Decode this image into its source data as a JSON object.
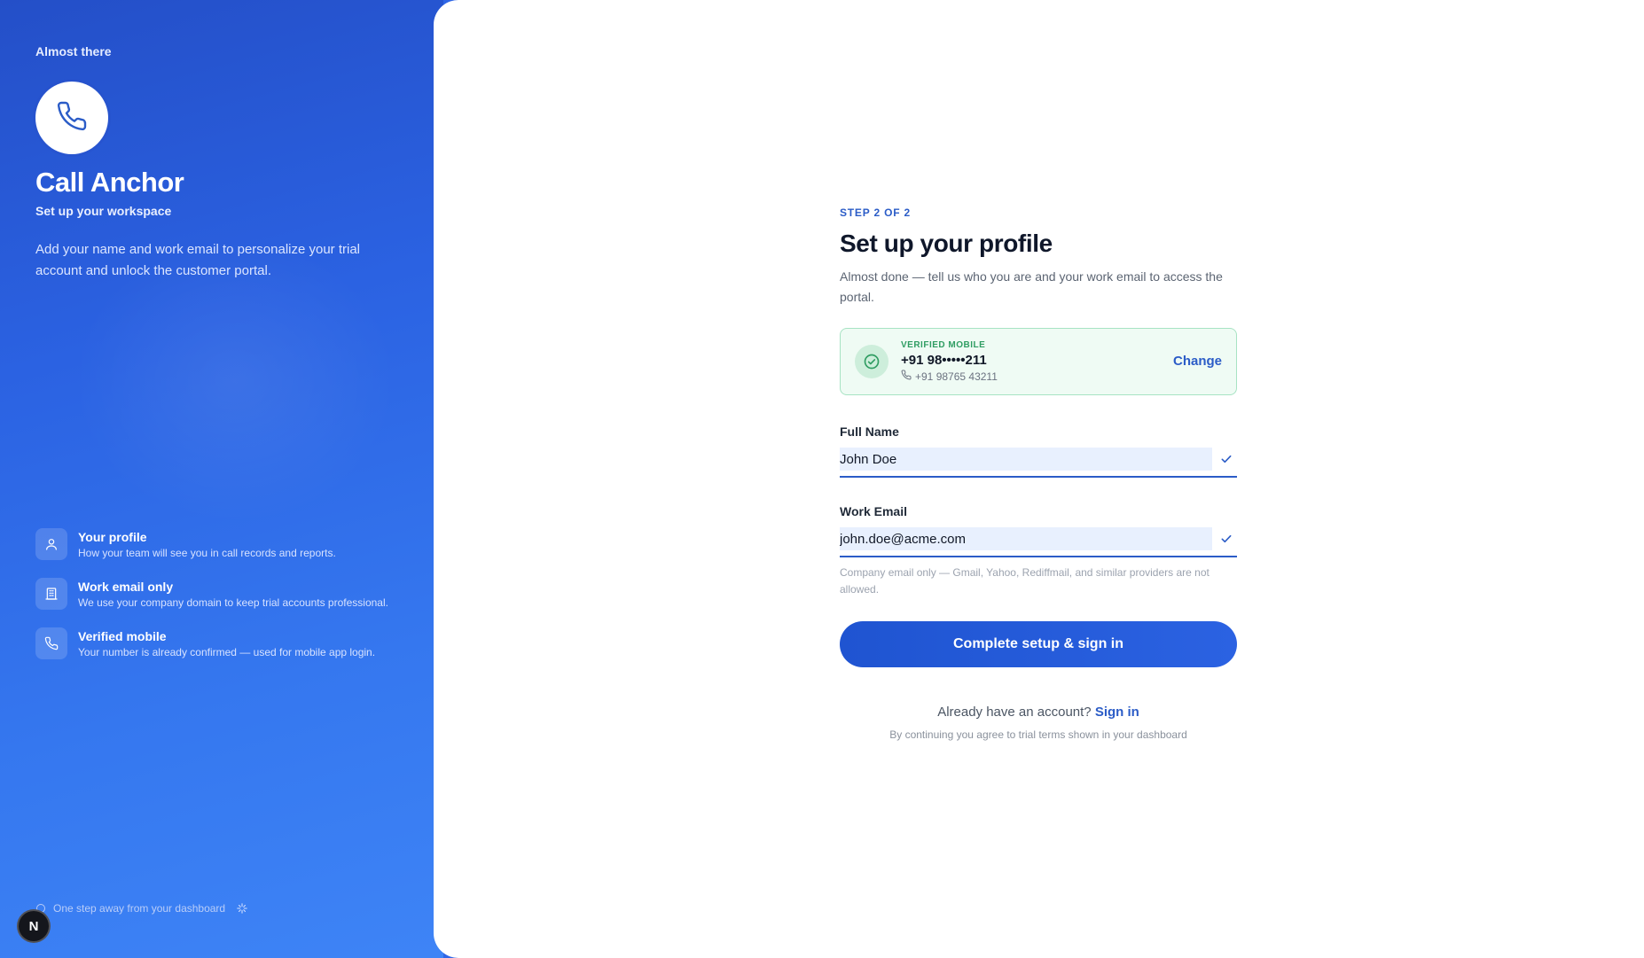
{
  "sidebar": {
    "eyebrow": "Almost there",
    "brand": "Call Anchor",
    "brand_sub": "Set up your workspace",
    "intro": "Add your name and work email to personalize your trial account and unlock the customer portal.",
    "features": [
      {
        "icon": "user-icon",
        "title": "Your profile",
        "desc": "How your team will see you in call records and reports."
      },
      {
        "icon": "building-icon",
        "title": "Work email only",
        "desc": "We use your company domain to keep trial accounts professional."
      },
      {
        "icon": "phone-icon",
        "title": "Verified mobile",
        "desc": "Your number is already confirmed — used for mobile app login."
      }
    ],
    "footer_note": "One step away from your dashboard",
    "badge": "N"
  },
  "form": {
    "step": "STEP 2 OF 2",
    "title": "Set up your profile",
    "subtitle": "Almost done — tell us who you are and your work email to access the portal.",
    "verified": {
      "label": "VERIFIED MOBILE",
      "masked": "+91 98•••••211",
      "full": "+91 98765 43211",
      "change_label": "Change"
    },
    "full_name": {
      "label": "Full Name",
      "value": "John Doe"
    },
    "work_email": {
      "label": "Work Email",
      "value": "john.doe@acme.com"
    },
    "email_hint": "Company email only — Gmail, Yahoo, Rediffmail, and similar providers are not allowed.",
    "cta": "Complete setup & sign in",
    "already_text": "Already have an account?",
    "signin_label": "Sign in",
    "terms": "By continuing you agree to trial terms shown in your dashboard"
  },
  "colors": {
    "accent": "#2b5cc7",
    "sidebar_gradient_start": "#244fc8",
    "sidebar_gradient_end": "#3e84f6",
    "verified_bg": "#effbf4",
    "verified_border": "#a7e3c3"
  }
}
